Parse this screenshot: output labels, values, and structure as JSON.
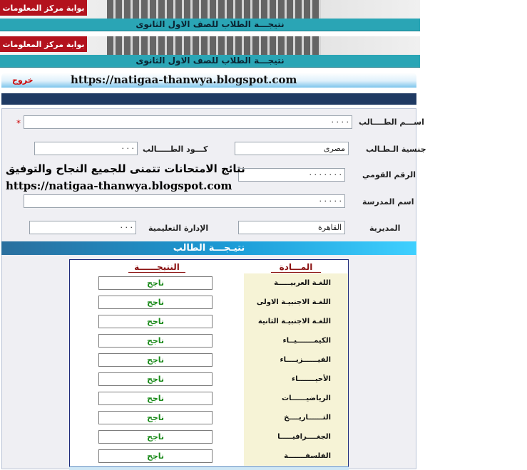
{
  "banner": {
    "logo_text": "بوابة مركز المعلومات",
    "title": "نتيجـــة الطلاب للصف الاول الثانوى"
  },
  "header": {
    "url": "https://natigaa-thanwya.blogspot.com",
    "logout": "خروج"
  },
  "form": {
    "name_label": "اســـم الطــــالب",
    "name_value": "· · · ·",
    "required_mark": "*",
    "nationality_label": "جنسية الـطـالب",
    "nationality_value": "مصرى",
    "code_label": "كـــود الطـــــالب",
    "code_value": "· · ·",
    "national_id_label": "الرقم القومي",
    "national_id_value": "· · · · · · ·",
    "school_label": "اسم المدرسة",
    "school_value": "· · · · ·",
    "directorate_label": "المديرية",
    "directorate_value": "القاهرة",
    "admin_label": "الإدارة التعليمية",
    "admin_value": "· · ·"
  },
  "overlay": {
    "arabic": "نتائج الامتحانات تتمنى للجميع النجاح والتوفيق",
    "url": "https://natigaa-thanwya.blogspot.com"
  },
  "results": {
    "section_title": "نتيـجـــة الطالب",
    "col_result": "النتيجــــــة",
    "col_subject": "المـــادة",
    "rows": [
      {
        "subject": "اللغـة العربيـــــة",
        "result": "ناجح"
      },
      {
        "subject": "اللغـة الاجنبيـة الاولى",
        "result": "ناجح"
      },
      {
        "subject": "اللغـة الاجنبيـة الثانية",
        "result": "ناجح"
      },
      {
        "subject": "الكيمـــــــيــاء",
        "result": "ناجح"
      },
      {
        "subject": "الفيــــــزيــــاء",
        "result": "ناجح"
      },
      {
        "subject": "الأحيـــــــاء",
        "result": "ناجح"
      },
      {
        "subject": "الرياضيــــــات",
        "result": "ناجح"
      },
      {
        "subject": "التــــــاريــــخ",
        "result": "ناجح"
      },
      {
        "subject": "الجغــــرافيـــــا",
        "result": "ناجح"
      },
      {
        "subject": "الفلسفـــــــة",
        "result": "ناجح"
      }
    ]
  },
  "colors": {
    "teal": "#2aa5b5",
    "navy": "#1f3a63",
    "pass_green": "#1a8a1a",
    "header_red": "#8a1010"
  }
}
